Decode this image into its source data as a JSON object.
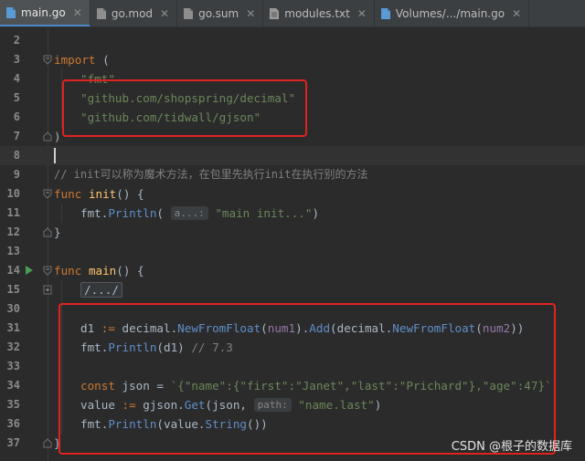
{
  "tabs": [
    {
      "label": "main.go",
      "active": true,
      "icon": "go-file-icon"
    },
    {
      "label": "go.mod",
      "active": false,
      "icon": "go-mod-file-icon"
    },
    {
      "label": "go.sum",
      "active": false,
      "icon": "go-sum-file-icon"
    },
    {
      "label": "modules.txt",
      "active": false,
      "icon": "text-file-icon"
    },
    {
      "label": "Volumes/.../main.go",
      "active": false,
      "icon": "go-file-icon"
    }
  ],
  "editor": {
    "line_numbers": {
      "l2": "2",
      "l3": "3",
      "l4": "4",
      "l5": "5",
      "l6": "6",
      "l7": "7",
      "l8": "8",
      "l9": "9",
      "l10": "10",
      "l11": "11",
      "l12": "12",
      "l13": "13",
      "l14": "14",
      "l15": "15",
      "l30": "30",
      "l31": "31",
      "l32": "32",
      "l33": "33",
      "l34": "34",
      "l35": "35",
      "l36": "36",
      "l37": "37"
    },
    "code": {
      "import_kw": "import",
      "import_open": " (",
      "pkg_fmt": "\"fmt\"",
      "pkg_decimal": "\"github.com/shopspring/decimal\"",
      "pkg_gjson": "\"github.com/tidwall/gjson\"",
      "close_paren": ")",
      "comment_init": "// init可以称为魔术方法，在包里先执行init在执行别的方法",
      "func_kw": "func",
      "init_name": "init",
      "fn_open": "() {",
      "fmt_pkg": "fmt.",
      "println": "Println",
      "paren_open": "(",
      "hint_a": "a...:",
      "str_main_init": "\"main init...\"",
      "paren_close": ")",
      "brace_close": "}",
      "main_name": "main",
      "folded": "/.../",
      "d1_var": "d1 ",
      "assign": ":=",
      "decimal_pkg": " decimal.",
      "new_from_float": "NewFromFloat",
      "num1": "num1",
      "add_part": ").",
      "add": "Add",
      "decimal_pkg2": "(decimal.",
      "num2": "num2",
      "close2": "))",
      "d1_arg": "(d1) ",
      "comment_73": "// 7.3",
      "const_kw": "const",
      "json_decl": " json = ",
      "json_literal": "`{\"name\":{\"first\":\"Janet\",\"last\":\"Prichard\"},\"age\":47}`",
      "value_var": "value ",
      "gjson_pkg": " gjson.",
      "get": "Get",
      "json_arg": "(json, ",
      "hint_path": "path:",
      "str_name_last": "\"name.last\"",
      "value_string_open": "(value.",
      "string_method": "String",
      "value_string_close": "())"
    }
  },
  "colors": {
    "highlight_box": "#e0231f",
    "keyword": "#cc7832",
    "string": "#6a8759"
  },
  "watermark": "CSDN @根子的数据库"
}
